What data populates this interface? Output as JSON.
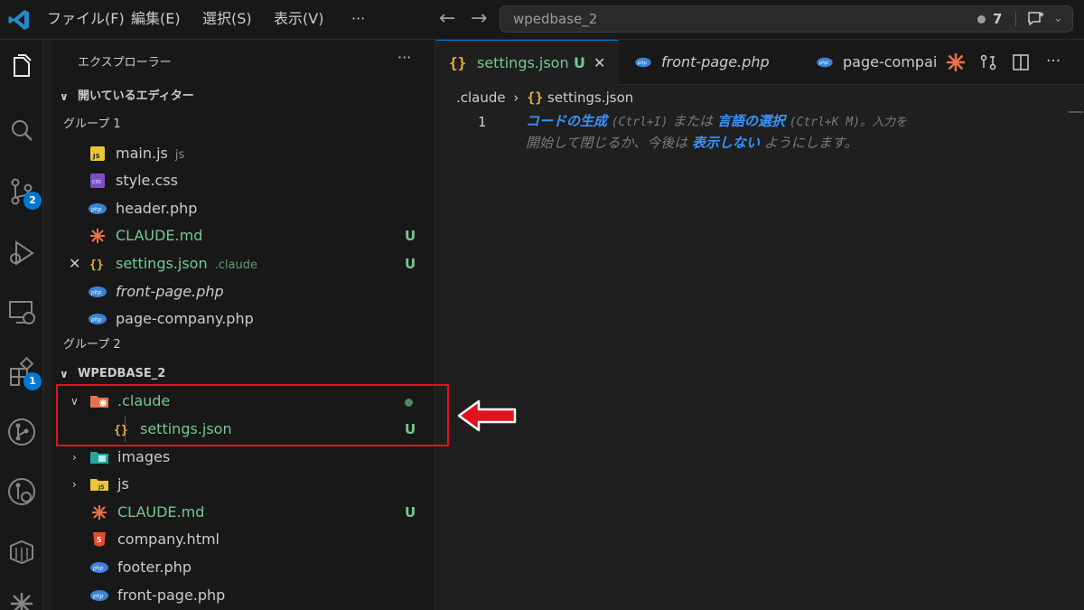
{
  "titlebar": {
    "menu": [
      "ファイル(F)",
      "編集(E)",
      "選択(S)",
      "表示(V)",
      "···"
    ],
    "search_text": "wpedbase_2",
    "notification_count": "7"
  },
  "activity": {
    "source_control_badge": "2",
    "extensions_badge": "1"
  },
  "sidebar": {
    "title": "エクスプローラー",
    "more": "···",
    "open_editors_label": "開いているエディター",
    "group1_label": "グループ 1",
    "group2_label": "グループ 2",
    "open_editors": [
      {
        "name": "main.js",
        "desc": "js",
        "status": ""
      },
      {
        "name": "style.css",
        "desc": "",
        "status": ""
      },
      {
        "name": "header.php",
        "desc": "",
        "status": ""
      },
      {
        "name": "CLAUDE.md",
        "desc": "",
        "status": "U"
      },
      {
        "name": "settings.json",
        "desc": ".claude",
        "status": "U"
      },
      {
        "name": "front-page.php",
        "desc": "",
        "status": ""
      },
      {
        "name": "page-company.php",
        "desc": "",
        "status": ""
      }
    ],
    "workspace_label": "WPEDBASE_2",
    "tree": [
      {
        "name": ".claude",
        "status": ""
      },
      {
        "name": "settings.json",
        "status": "U"
      },
      {
        "name": "images",
        "status": ""
      },
      {
        "name": "js",
        "status": ""
      },
      {
        "name": "CLAUDE.md",
        "status": "U"
      },
      {
        "name": "company.html",
        "status": ""
      },
      {
        "name": "footer.php",
        "status": ""
      },
      {
        "name": "front-page.php",
        "status": ""
      }
    ]
  },
  "tabs": [
    {
      "label": "settings.json",
      "status": "U"
    },
    {
      "label": "front-page.php"
    },
    {
      "label": "page-compai"
    }
  ],
  "breadcrumb": {
    "folder": ".claude",
    "file": "settings.json"
  },
  "editor": {
    "line_number": "1",
    "hint_link1": "コードの生成",
    "hint_key1": "(Ctrl+I)",
    "hint_or": "または",
    "hint_link2": "言語の選択",
    "hint_key2": "(Ctrl+K M)。入力を",
    "hint_line2_a": "開始して閉じるか、今後は",
    "hint_link3": "表示しない",
    "hint_line2_b": "ようにします。"
  },
  "colors": {
    "accent": "#0078d4",
    "untracked": "#73c991",
    "highlight": "#e0141e"
  }
}
